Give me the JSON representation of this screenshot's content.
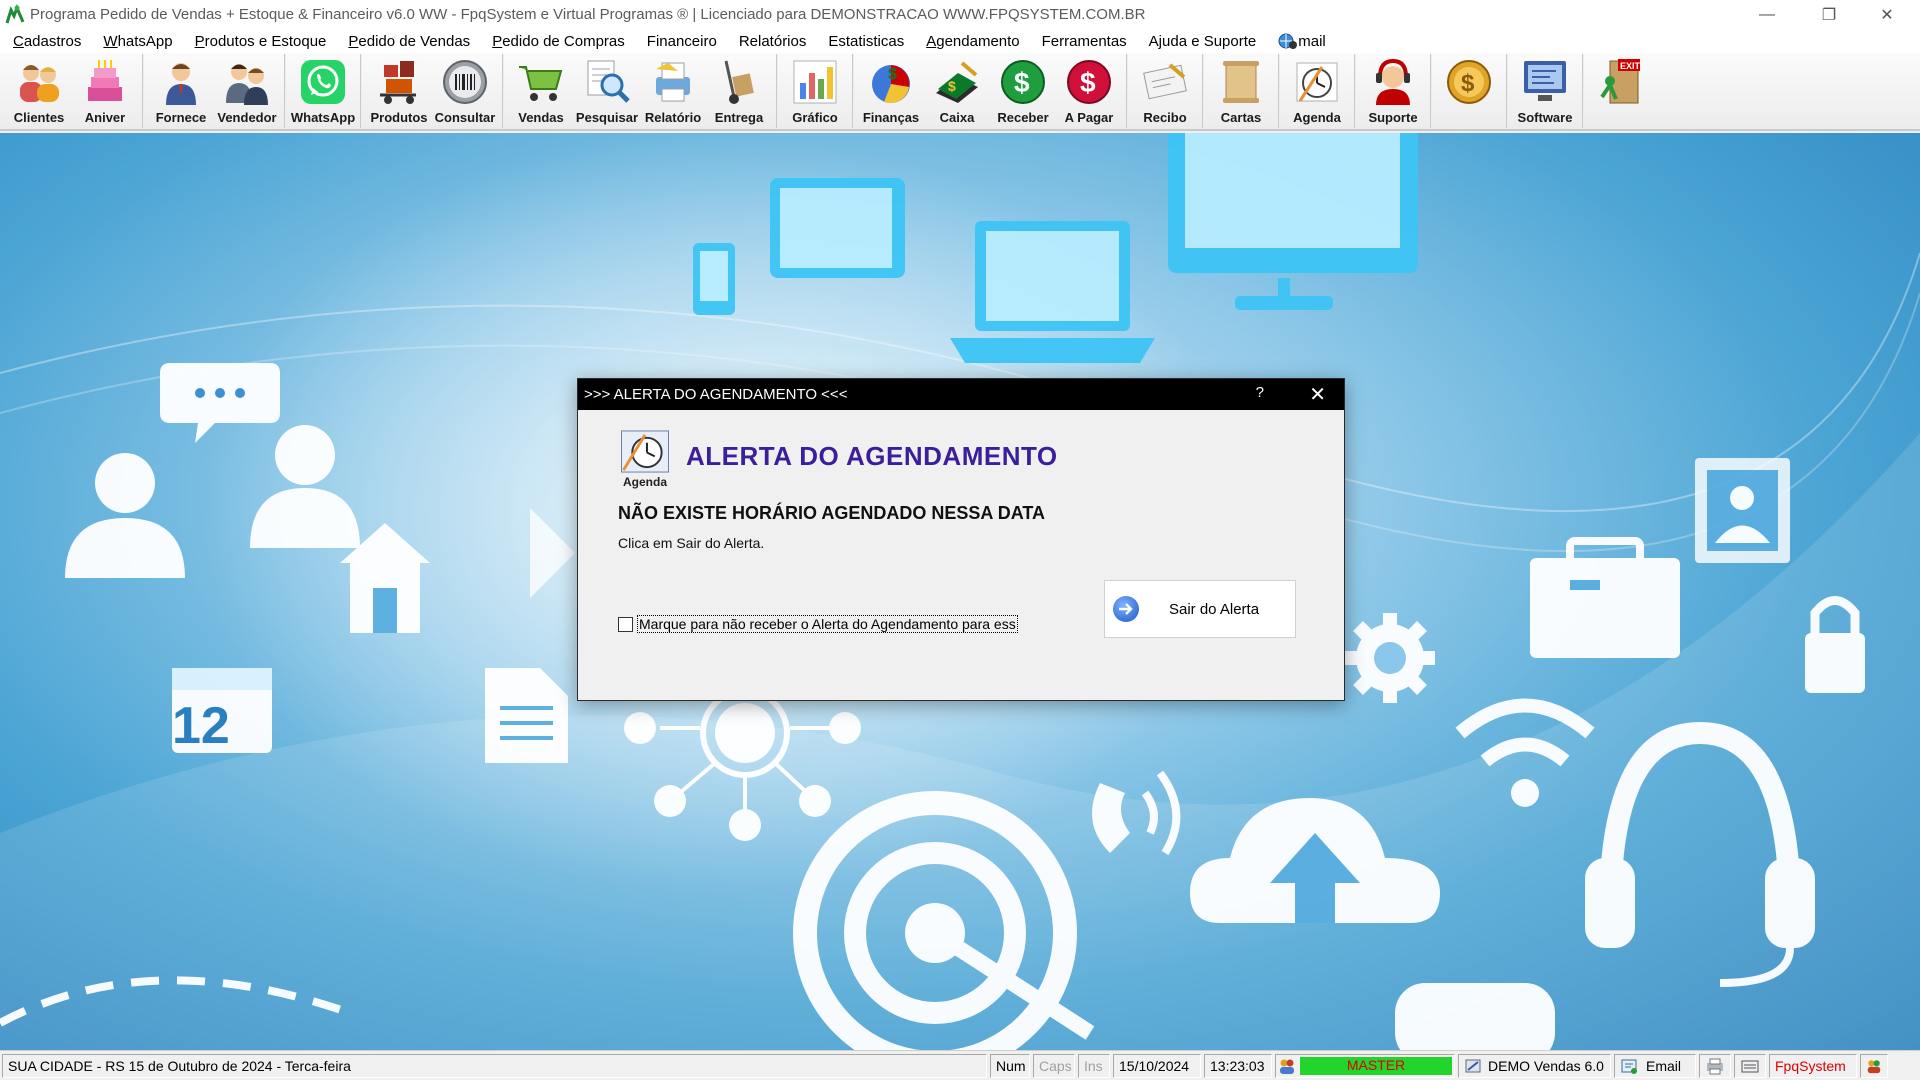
{
  "window": {
    "title": "Programa Pedido de Vendas + Estoque & Financeiro v6.0 WW - FpqSystem e Virtual Programas ® | Licenciado para  DEMONSTRACAO WWW.FPQSYSTEM.COM.BR"
  },
  "menu": [
    {
      "u": "C",
      "rest": "adastros"
    },
    {
      "u": "W",
      "rest": "hatsApp"
    },
    {
      "u": "P",
      "rest": "rodutos e Estoque"
    },
    {
      "u": "P",
      "rest": "edido de Vendas"
    },
    {
      "u": "P",
      "rest": "edido de Compras"
    },
    {
      "u": "",
      "rest": "Financeiro"
    },
    {
      "u": "",
      "rest": "Relatórios"
    },
    {
      "u": "",
      "rest": "Estatisticas"
    },
    {
      "u": "A",
      "rest": "gendamento"
    },
    {
      "u": "",
      "rest": "Ferramentas"
    },
    {
      "u": "",
      "rest": "Ajuda e Suporte"
    },
    {
      "u": "",
      "rest": "mail"
    }
  ],
  "toolbar": {
    "clientes": "Clientes",
    "aniver": "Aniver",
    "fornece": "Fornece",
    "vendedor": "Vendedor",
    "whatsapp": "WhatsApp",
    "produtos": "Produtos",
    "consultar": "Consultar",
    "vendas": "Vendas",
    "pesquisar": "Pesquisar",
    "relatorio": "Relatório",
    "entrega": "Entrega",
    "grafico": "Gráfico",
    "financas": "Finanças",
    "caixa": "Caixa",
    "receber": "Receber",
    "apagar": "A Pagar",
    "recibo": "Recibo",
    "cartas": "Cartas",
    "agenda": "Agenda",
    "suporte": "Suporte",
    "software": "Software",
    "exit_sign": "EXIT"
  },
  "desktop": {
    "calendar_day": "12"
  },
  "dialog": {
    "title": ">>> ALERTA DO AGENDAMENTO <<<",
    "help": "?",
    "icon_label": "Agenda",
    "heading": "ALERTA DO AGENDAMENTO",
    "message": "NÃO EXISTE HORÁRIO AGENDADO NESSA DATA",
    "sub": "Clica em Sair do Alerta.",
    "checkbox_label": "Marque para não receber o Alerta do Agendamento para ess",
    "button_label": "Sair do Alerta",
    "checked": false
  },
  "status": {
    "city": "SUA CIDADE - RS 15 de Outubro de 2024 - Terca-feira",
    "num": "Num",
    "caps": "Caps",
    "ins": "Ins",
    "date": "15/10/2024",
    "time": "13:23:03",
    "user": "MASTER",
    "demo": "DEMO Vendas 6.0",
    "email": "Email",
    "brand": "FpqSystem"
  },
  "colors": {
    "heading": "#3b1e9b",
    "master_bg": "#22d42b",
    "master_fg": "#dd0000",
    "brand_fg": "#dd0000"
  }
}
